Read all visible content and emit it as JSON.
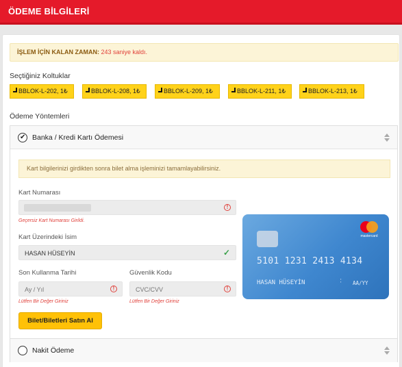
{
  "header": {
    "title": "ÖDEME BİLGİLERİ"
  },
  "timer": {
    "label": "İŞLEM İÇİN KALAN ZAMAN:",
    "value": "243 saniye kaldı."
  },
  "seats_section": {
    "label": "Seçtiğiniz Koltuklar",
    "seats": [
      "BBLOK-L-202, 1₺",
      "BBLOK-L-208, 1₺",
      "BBLOK-L-209, 1₺",
      "BBLOK-L-211, 1₺",
      "BBLOK-L-213, 1₺"
    ]
  },
  "payment_methods": {
    "label": "Ödeme Yöntemleri",
    "card_method": {
      "title": "Banka / Kredi Kartı Ödemesi",
      "info": "Kart bilgilerinizi girdikten sonra bilet alma işleminizi tamamlayabilirsiniz.",
      "card_number": {
        "label": "Kart Numarası",
        "error": "Geçersiz Kart Numarası Girildi."
      },
      "card_name": {
        "label": "Kart Üzerindeki İsim",
        "value": "HASAN HÜSEYİN"
      },
      "expiry": {
        "label": "Son Kullanma Tarihi",
        "placeholder": "Ay / Yıl",
        "error": "Lütfen Bir Değer Giriniz"
      },
      "cvc": {
        "label": "Güvenlik Kodu",
        "placeholder": "CVC/CVV",
        "error": "Lütfen Bir Değer Giriniz"
      },
      "buy_button": "Bilet/Biletleri Satın Al"
    },
    "cash_method": {
      "title": "Nakit Ödeme"
    }
  },
  "card_preview": {
    "number": "5101 1231 2413 4134",
    "name": "HASAN HÜSEYİN",
    "expiry": "AA/YY",
    "brand": "mastercard",
    "colors": {
      "card": "#3f87cf",
      "mc_red": "#eb001b",
      "mc_yellow": "#f79e1b"
    }
  },
  "colors": {
    "header": "#e51a2a",
    "seat": "#ffd21a",
    "button": "#ffc107",
    "error": "#e0403a",
    "ok": "#3aa14b"
  }
}
